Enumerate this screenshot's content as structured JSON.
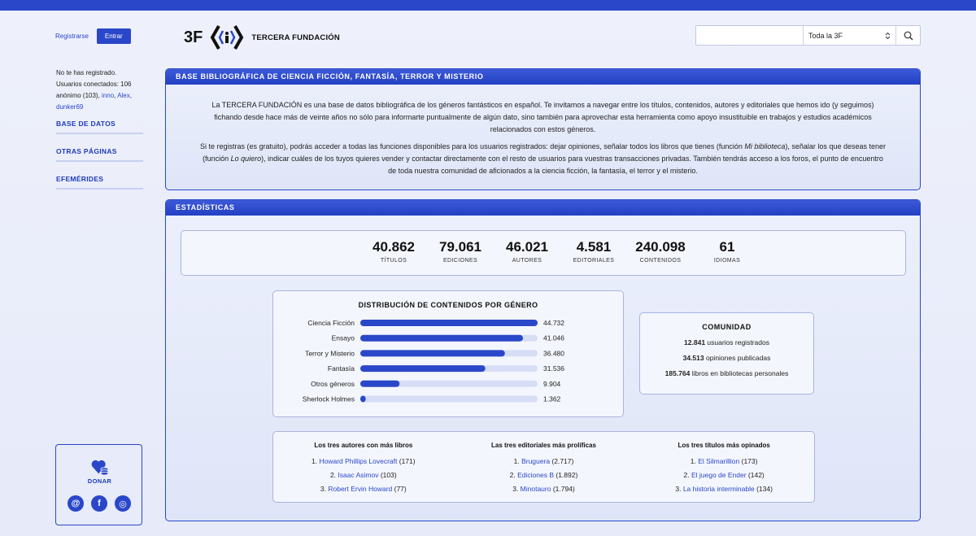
{
  "sidebar": {
    "register_label": "Registrarse",
    "enter_label": "Entrar",
    "not_registered": "No te has registrado.",
    "connected_users": "Usuarios conectados: 106",
    "anon": "anónimo (103),",
    "user1": "inno",
    "user2": "Alex",
    "user3": "dunker69",
    "nav": [
      "BASE DE DATOS",
      "OTRAS PÁGINAS",
      "EFEMÉRIDES"
    ],
    "donate_label": "DONAR",
    "social": [
      {
        "icon": "email-icon",
        "glyph": "@"
      },
      {
        "icon": "facebook-icon",
        "glyph": "f"
      },
      {
        "icon": "instagram-icon",
        "glyph": "◎"
      }
    ]
  },
  "header": {
    "logo_mark": "3F",
    "logo_text": "TERCERA FUNDACIÓN",
    "search_placeholder": "",
    "search_scope": "Toda la 3F"
  },
  "intro": {
    "title": "BASE BIBLIOGRÁFICA DE CIENCIA FICCIÓN, FANTASÍA, TERROR Y MISTERIO",
    "p1": "La TERCERA FUNDACIÓN es una base de datos bibliográfica de los géneros fantásticos en español. Te invitamos a navegar entre los títulos, contenidos, autores y editoriales que hemos ido (y seguimos) fichando desde hace más de veinte años no sólo para informarte puntualmente de algún dato, sino también para aprovechar esta herramienta como apoyo insustituible en trabajos y estudios académicos relacionados con estos géneros.",
    "p2a": "Si te registras (es gratuito), podrás acceder a todas las funciones disponibles para los usuarios registrados: dejar opiniones, señalar todos los libros que tienes (función ",
    "p2_em1": "Mi biblioteca",
    "p2b": "), señalar los que deseas tener (función ",
    "p2_em2": "Lo quiero",
    "p2c": "), indicar cuáles de los tuyos quieres vender y contactar directamente con el resto de usuarios para vuestras transacciones privadas. También tendrás acceso a los foros, el punto de encuentro de toda nuestra comunidad de aficionados a la ciencia ficción, la fantasía, el terror y el misterio."
  },
  "stats": {
    "title": "ESTADÍSTICAS",
    "items": [
      {
        "value": "40.862",
        "label": "TÍTULOS"
      },
      {
        "value": "79.061",
        "label": "EDICIONES"
      },
      {
        "value": "46.021",
        "label": "AUTORES"
      },
      {
        "value": "4.581",
        "label": "EDITORIALES"
      },
      {
        "value": "240.098",
        "label": "CONTENIDOS"
      },
      {
        "value": "61",
        "label": "IDIOMAS"
      }
    ]
  },
  "chart_data": {
    "type": "bar",
    "title": "DISTRIBUCIÓN DE CONTENIDOS POR GÉNERO",
    "categories": [
      "Ciencia Ficción",
      "Ensayo",
      "Terror y Misterio",
      "Fantasía",
      "Otros géneros",
      "Sherlock Holmes"
    ],
    "values": [
      44732,
      41046,
      36480,
      31536,
      9904,
      1362
    ],
    "value_labels": [
      "44.732",
      "41.046",
      "36.480",
      "31.536",
      "9.904",
      "1.362"
    ],
    "orientation": "horizontal",
    "xlim": [
      0,
      44732
    ],
    "colors": {
      "bar": "#2a47c9",
      "track": "#d7ddf5"
    }
  },
  "community": {
    "title": "COMUNIDAD",
    "lines": [
      {
        "num": "12.841",
        "text": " usuarios registrados"
      },
      {
        "num": "34.513",
        "text": " opiniones publicadas"
      },
      {
        "num": "185.764",
        "text": " libros en bibliotecas personales"
      }
    ]
  },
  "top3": [
    {
      "head": "Los tres autores con más libros",
      "items": [
        {
          "n": "1.",
          "name": "Howard Phillips Lovecraft",
          "count": "(171)"
        },
        {
          "n": "2.",
          "name": "Isaac Asimov",
          "count": "(103)"
        },
        {
          "n": "3.",
          "name": "Robert Ervin Howard",
          "count": "(77)"
        }
      ]
    },
    {
      "head": "Las tres editoriales más prolíficas",
      "items": [
        {
          "n": "1.",
          "name": "Bruguera",
          "count": "(2.717)"
        },
        {
          "n": "2.",
          "name": "Ediciones B",
          "count": "(1.892)"
        },
        {
          "n": "3.",
          "name": "Minotauro",
          "count": "(1.794)"
        }
      ]
    },
    {
      "head": "Los tres títulos más opinados",
      "items": [
        {
          "n": "1.",
          "name": "El Silmarillion",
          "count": "(173)"
        },
        {
          "n": "2.",
          "name": "El juego de Ender",
          "count": "(142)"
        },
        {
          "n": "3.",
          "name": "La historia interminable",
          "count": "(134)"
        }
      ]
    }
  ]
}
